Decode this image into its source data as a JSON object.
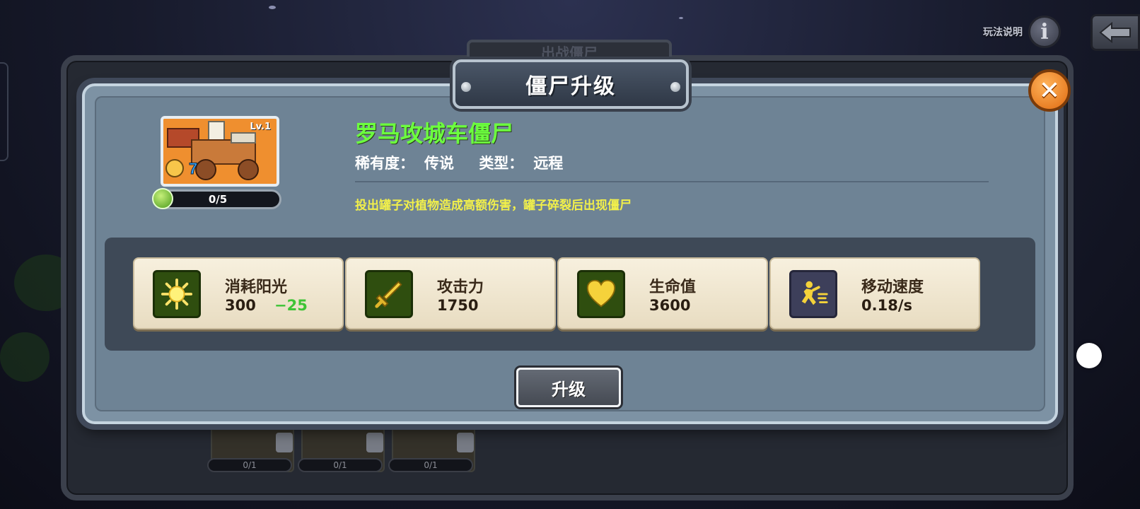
{
  "help": {
    "label": "玩法说明",
    "icon": "info-icon"
  },
  "back": {
    "icon": "back-arrow-icon"
  },
  "background": {
    "tab_label": "出战僵尸",
    "cards": [
      {
        "progress": "0/1"
      },
      {
        "progress": "0/1"
      },
      {
        "progress": "0/1"
      }
    ]
  },
  "modal": {
    "title": "僵尸升级",
    "close_icon": "close-icon",
    "card": {
      "level": "Lv.1",
      "progress": "0/5"
    },
    "zombie_name": "罗马攻城车僵尸",
    "rarity_label": "稀有度：",
    "rarity": "传说",
    "type_label": "类型：",
    "type": "远程",
    "description": "投出罐子对植物造成高额伤害，罐子碎裂后出现僵尸",
    "stats": [
      {
        "label": "消耗阳光",
        "value": "300",
        "delta": "−25",
        "icon": "sun-icon"
      },
      {
        "label": "攻击力",
        "value": "1750",
        "icon": "sword-icon"
      },
      {
        "label": "生命值",
        "value": "3600",
        "icon": "heart-icon"
      },
      {
        "label": "移动速度",
        "value": "0.18/s",
        "icon": "running-zombie-icon"
      }
    ],
    "upgrade_label": "升级"
  },
  "colors": {
    "name": "#6cff3e",
    "description": "#f2f04a",
    "delta": "#3fc436",
    "close": "#e06a10"
  }
}
